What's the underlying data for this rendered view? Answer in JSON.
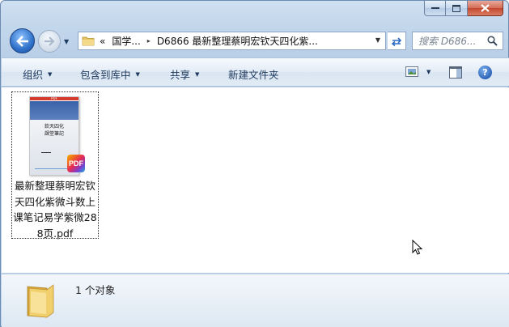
{
  "window": {
    "caption": {
      "minimize_glyph": "—",
      "maximize_glyph": "☐",
      "close_glyph": "✕"
    }
  },
  "nav": {
    "address_prefix": "«",
    "address_segment_1": "国学...",
    "address_separator": "▸",
    "address_segment_2": "D6866 最新整理蔡明宏钦天四化紫...",
    "dropdown_glyph": "▼",
    "search_placeholder": "搜索 D686..."
  },
  "toolbar": {
    "organize_label": "组织",
    "include_library_label": "包含到库中",
    "share_label": "共享",
    "new_folder_label": "新建文件夹",
    "help_glyph": "?"
  },
  "file": {
    "thumbnail_header": "PDF",
    "thumbnail_title_line1": "欽天四化",
    "thumbnail_title_line2": "課堂筆記",
    "badge_label": "PDF",
    "name": "最新整理蔡明宏钦天四化紫微斗数上课笔记易学紫微288页.pdf"
  },
  "details": {
    "item_count": "1 个对象"
  },
  "colors": {
    "frame": "#b9cfe7",
    "toolbar_text": "#1e395b",
    "close_button": "#c4472f",
    "accent_blue": "#2f71c9"
  }
}
